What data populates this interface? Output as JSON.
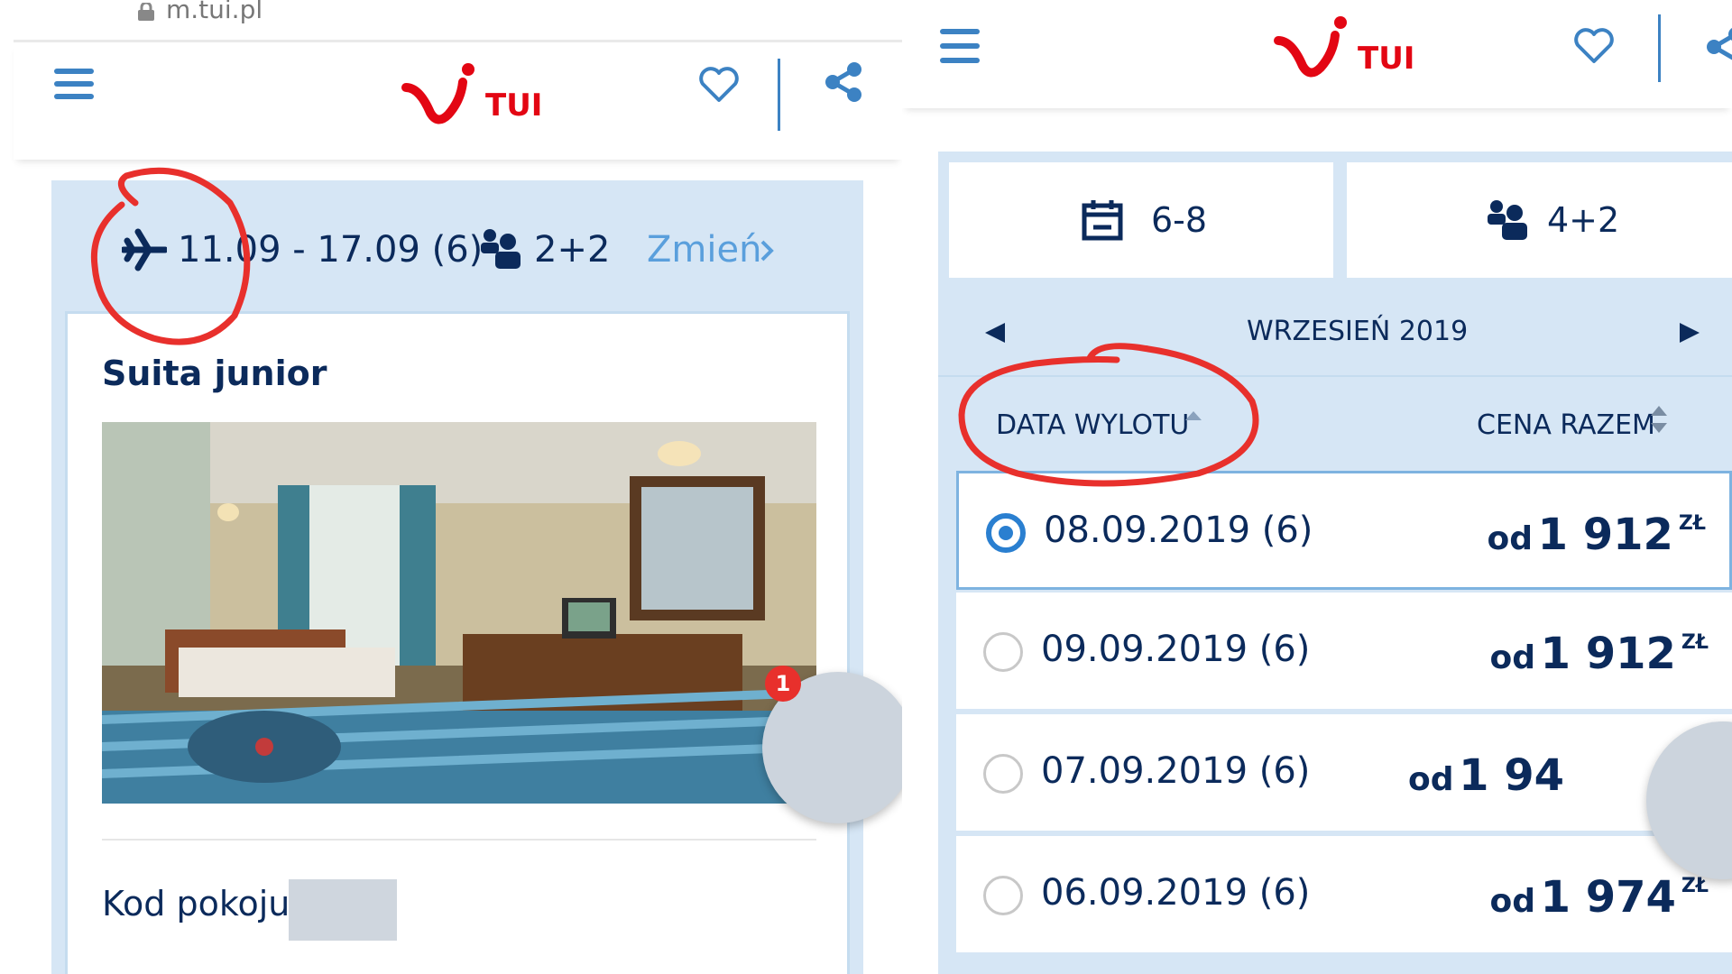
{
  "left_screen": {
    "url": "m.tui.pl",
    "header": {
      "logo_text": "TUI",
      "menu_icon": "hamburger-icon",
      "favorite_icon": "heart-icon",
      "share_icon": "share-icon"
    },
    "summary": {
      "dates": "11.09 - 17.09 (6)",
      "pax": "2+2",
      "change_label": "Zmień"
    },
    "room": {
      "title": "Suita junior",
      "photo": "hotel-room-photo",
      "code_label": "Kod pokoju:",
      "description": "…"
    },
    "badge_count": "1"
  },
  "right_screen": {
    "header": {
      "logo_text": "TUI",
      "menu_icon": "hamburger-icon",
      "favorite_icon": "heart-icon",
      "share_icon": "share-icon"
    },
    "filters": {
      "nights": "6-8",
      "pax": "4+2"
    },
    "month": "WRZESIEŃ 2019",
    "sort": {
      "date_col": "DATA WYLOTU",
      "price_col": "CENA RAZEM"
    },
    "departures": [
      {
        "date": "08.09.2019 (6)",
        "prefix": "od",
        "price": "1 912",
        "currency": "ZŁ",
        "selected": true
      },
      {
        "date": "09.09.2019 (6)",
        "prefix": "od",
        "price": "1 912",
        "currency": "ZŁ",
        "selected": false
      },
      {
        "date": "07.09.2019 (6)",
        "prefix": "od",
        "price": "1 94",
        "currency": "",
        "selected": false
      },
      {
        "date": "06.09.2019 (6)",
        "prefix": "od",
        "price": "1 974",
        "currency": "ZŁ",
        "selected": false
      }
    ]
  },
  "colors": {
    "brand_navy": "#0b2a5b",
    "tui_red": "#e30613",
    "accent_blue": "#3c82c3",
    "panel_blue": "#d6e6f5",
    "annotation_red": "#e8302c"
  }
}
